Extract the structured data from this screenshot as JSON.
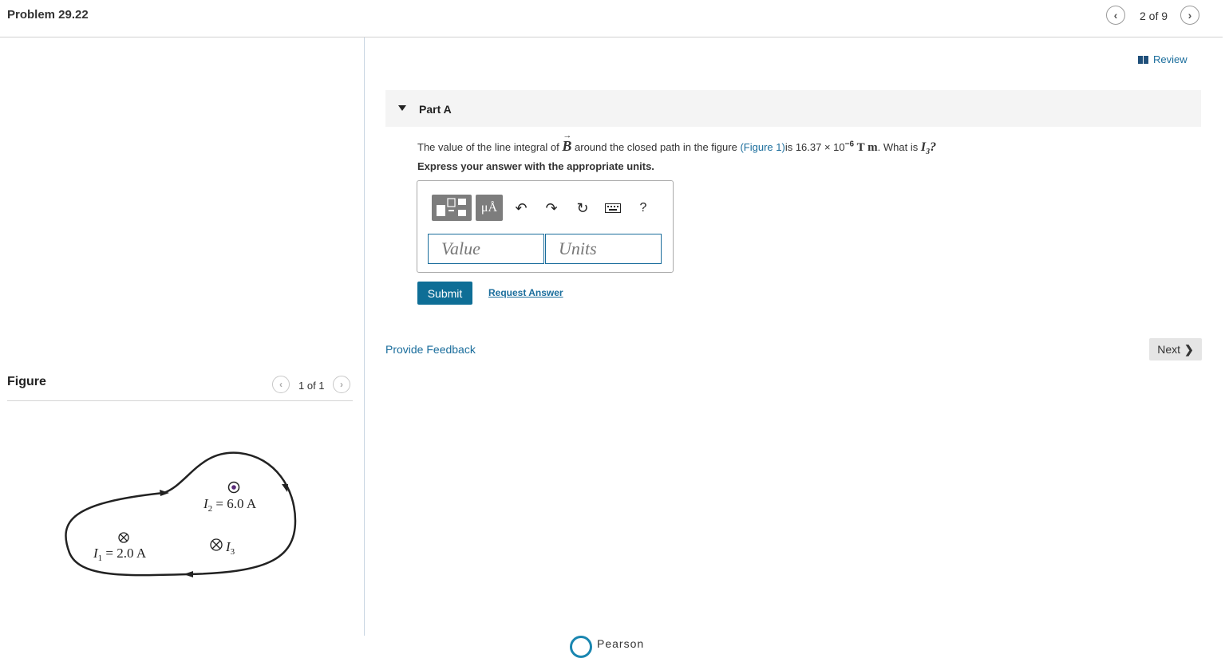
{
  "header": {
    "title": "Problem 29.22",
    "page_counter": "2 of 9",
    "prev_icon": "chevron-left-icon",
    "next_icon": "chevron-right-icon"
  },
  "review": {
    "label": "Review",
    "icon": "book-icon"
  },
  "part": {
    "label": "Part A",
    "question": {
      "prefix": "The value of the line integral of ",
      "symbol": "B",
      "mid": " around the closed path in the figure ",
      "figure_link": "(Figure 1)",
      "mid2": "is 16.37 × 10",
      "exponent": "−6",
      "units": "T m",
      "suffix": ". What is ",
      "target": "I",
      "target_sub": "3",
      "end": "?"
    },
    "instruction": "Express your answer with the appropriate units.",
    "toolbar": {
      "units_label": "μÅ",
      "help_label": "?"
    },
    "value_placeholder": "Value",
    "units_placeholder": "Units",
    "submit_label": "Submit",
    "request_label": "Request Answer"
  },
  "feedback_label": "Provide Feedback",
  "next_label": "Next",
  "figure": {
    "heading": "Figure",
    "counter": "1 of 1",
    "i1_label": "I",
    "i1_sub": "1",
    "i1_value": " = 2.0 A",
    "i2_label": "I",
    "i2_sub": "2",
    "i2_value": " = 6.0 A",
    "i3_label": "I",
    "i3_sub": "3"
  },
  "colors": {
    "accent": "#1a6d9c",
    "submit": "#0e6e96",
    "pearson": "#1a86b0"
  },
  "footer": {
    "brand": "Pearson"
  }
}
